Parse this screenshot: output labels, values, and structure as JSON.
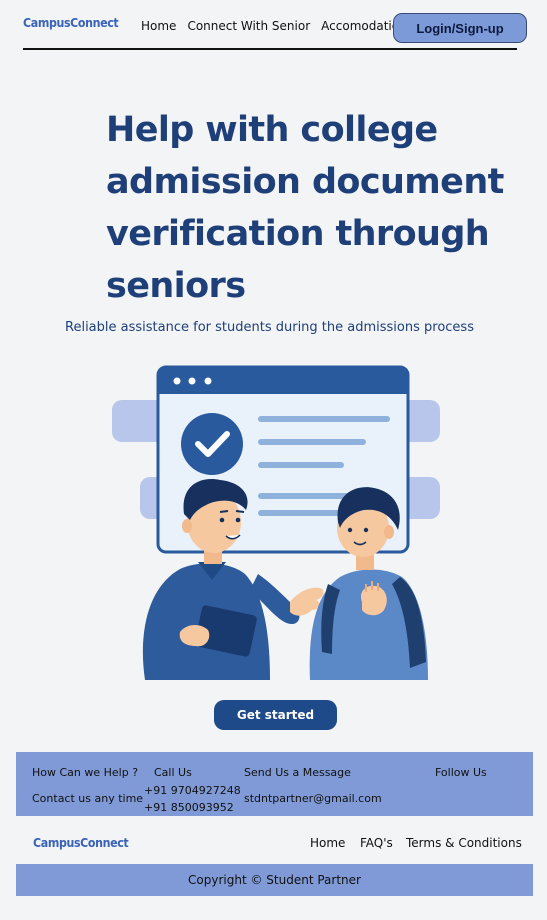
{
  "nav": {
    "logo": "CampusConnect",
    "links": [
      "Home",
      "Connect With Senior",
      "Accomodation"
    ],
    "login_label": "Login/Sign-up"
  },
  "hero": {
    "title_lines": [
      "Help with college",
      "admission document",
      "verification through",
      "seniors"
    ],
    "subtitle": "Reliable assistance for students during the admissions process",
    "cta_label": "Get started"
  },
  "footer": {
    "help_heading": "How Can we Help ?",
    "help_text": "Contact us any time",
    "call_heading": "Call Us",
    "phones": [
      "+91 9704927248",
      "+91 850093952"
    ],
    "message_heading": "Send Us a Message",
    "email": "stdntpartner@gmail.com",
    "follow_heading": "Follow Us",
    "logo": "CampusConnect",
    "links": [
      "Home",
      "FAQ's",
      "Terms & Conditions"
    ],
    "copyright": "Copyright © Student Partner"
  },
  "colors": {
    "accent": "#1e4a8a",
    "title": "#1e3f78",
    "footer_band": "#7f9ad6",
    "login_button": "#7d9ad8",
    "background": "#f2f4f6"
  }
}
